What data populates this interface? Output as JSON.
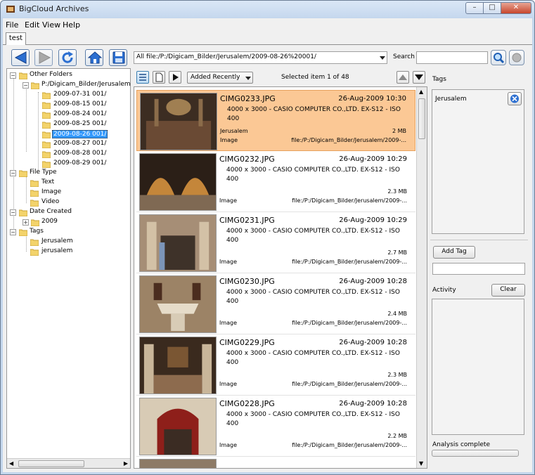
{
  "window": {
    "title": "BigCloud Archives"
  },
  "menu": [
    "File",
    "Edit",
    "View",
    "Help"
  ],
  "tab": {
    "label": "test"
  },
  "toolbar": {
    "path": "All file:/P:/Digicam_Bilder/Jerusalem/2009-08-26%20001/",
    "search_label": "Search",
    "search_value": ""
  },
  "tree": {
    "other_folders": "Other Folders",
    "root_path": "P:/Digicam_Bilder/Jerusalem/",
    "dates": [
      "2009-07-31 001/",
      "2009-08-15 001/",
      "2009-08-24 001/",
      "2009-08-25 001/",
      "2009-08-26 001/",
      "2009-08-27 001/",
      "2009-08-28 001/",
      "2009-08-29 001/"
    ],
    "file_type": "File Type",
    "file_types": [
      "Text",
      "Image",
      "Video"
    ],
    "date_created": "Date Created",
    "year": "2009",
    "tags": "Tags",
    "tag_items": [
      "Jerusalem",
      "jerusalem"
    ]
  },
  "list": {
    "sort": "Added Recently",
    "selected_info": "Selected item 1 of 48",
    "items": [
      {
        "name": "CIMG0233.JPG",
        "date": "26-Aug-2009 10:30",
        "meta": "4000 x 3000 - CASIO COMPUTER CO.,LTD. EX-S12 - ISO 400",
        "tag": "Jerusalem",
        "size": "2 MB",
        "type": "Image",
        "path": "file:/P:/Digicam_Bilder/Jerusalem/2009-..."
      },
      {
        "name": "CIMG0232.JPG",
        "date": "26-Aug-2009 10:29",
        "meta": "4000 x 3000 - CASIO COMPUTER CO.,LTD. EX-S12 - ISO 400",
        "tag": "",
        "size": "2.3 MB",
        "type": "Image",
        "path": "file:/P:/Digicam_Bilder/Jerusalem/2009-..."
      },
      {
        "name": "CIMG0231.JPG",
        "date": "26-Aug-2009 10:29",
        "meta": "4000 x 3000 - CASIO COMPUTER CO.,LTD. EX-S12 - ISO 400",
        "tag": "",
        "size": "2.7 MB",
        "type": "Image",
        "path": "file:/P:/Digicam_Bilder/Jerusalem/2009-..."
      },
      {
        "name": "CIMG0230.JPG",
        "date": "26-Aug-2009 10:28",
        "meta": "4000 x 3000 - CASIO COMPUTER CO.,LTD. EX-S12 - ISO 400",
        "tag": "",
        "size": "2.4 MB",
        "type": "Image",
        "path": "file:/P:/Digicam_Bilder/Jerusalem/2009-..."
      },
      {
        "name": "CIMG0229.JPG",
        "date": "26-Aug-2009 10:28",
        "meta": "4000 x 3000 - CASIO COMPUTER CO.,LTD. EX-S12 - ISO 400",
        "tag": "",
        "size": "2.3 MB",
        "type": "Image",
        "path": "file:/P:/Digicam_Bilder/Jerusalem/2009-..."
      },
      {
        "name": "CIMG0228.JPG",
        "date": "26-Aug-2009 10:28",
        "meta": "4000 x 3000 - CASIO COMPUTER CO.,LTD. EX-S12 - ISO 400",
        "tag": "",
        "size": "2.2 MB",
        "type": "Image",
        "path": "file:/P:/Digicam_Bilder/Jerusalem/2009-..."
      }
    ]
  },
  "right": {
    "tags_label": "Tags",
    "tag": "Jerusalem",
    "add_tag": "Add Tag",
    "activity_label": "Activity",
    "clear": "Clear",
    "status": "Analysis complete"
  },
  "colors": {
    "selection": "#fbc895",
    "tree_selection": "#3399ff",
    "accent_blue": "#2c6fd1"
  }
}
